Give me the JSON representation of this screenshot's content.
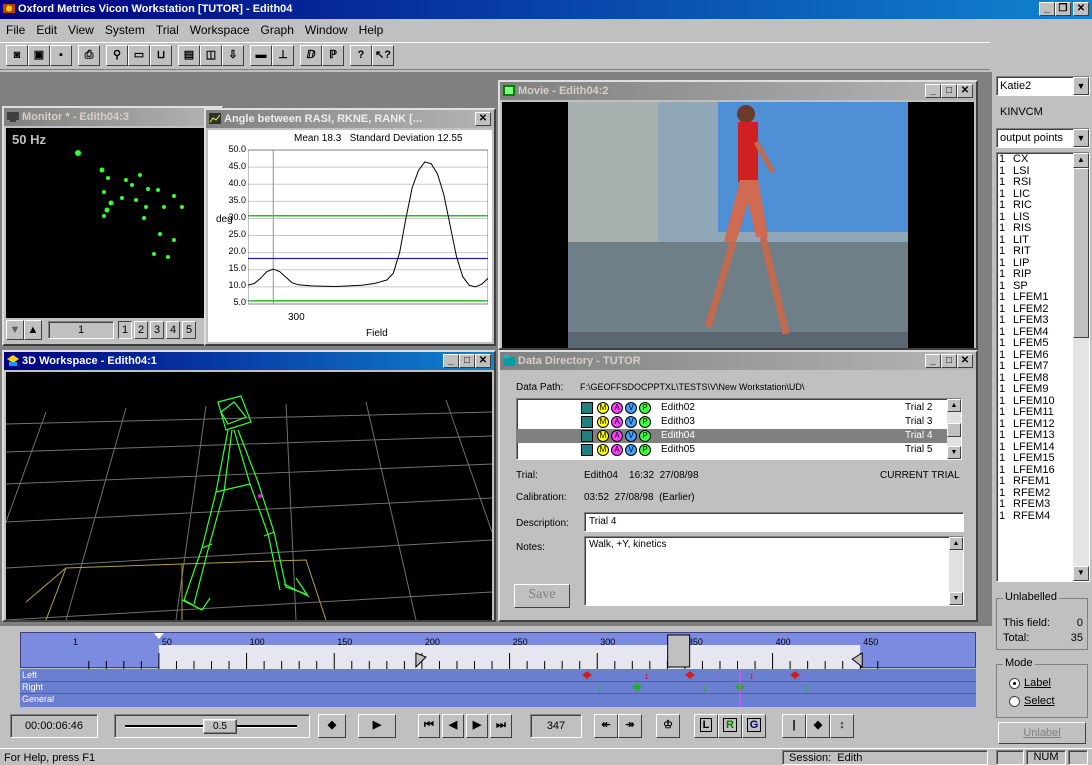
{
  "app": {
    "title": "Oxford Metrics Vicon Workstation [TUTOR] - Edith04"
  },
  "menu": [
    {
      "label": "File"
    },
    {
      "label": "Edit"
    },
    {
      "label": "View"
    },
    {
      "label": "System"
    },
    {
      "label": "Trial"
    },
    {
      "label": "Workspace"
    },
    {
      "label": "Graph"
    },
    {
      "label": "Window"
    },
    {
      "label": "Help"
    }
  ],
  "toolbar": {
    "icons": [
      "new-icon",
      "open-icon",
      "save-icon",
      "print-icon",
      "run-icon",
      "monitor-icon",
      "capture-icon",
      "pipeline-icon",
      "camera-icon",
      "export-icon",
      "graph-icon",
      "axis-icon",
      "reconstruct-icon",
      "label-icon",
      "help-icon",
      "context-help-icon"
    ]
  },
  "monitor": {
    "title": "Monitor * - Edith04:3",
    "rate": "50 Hz",
    "frame_value": "1",
    "pages": [
      "1",
      "2",
      "3",
      "4",
      "5"
    ]
  },
  "angle_graph": {
    "title": "Angle between RASI, RKNE, RANK [...",
    "stats": "Mean 18.3   Standard Deviation 12.55",
    "ylabel": "deg",
    "xlabel": "Field",
    "xtick": "300",
    "yticks": [
      "50.0",
      "45.0",
      "40.0",
      "35.0",
      "30.0",
      "25.0",
      "20.0",
      "15.0",
      "10.0",
      "5.0"
    ]
  },
  "chart_data": {
    "type": "line",
    "title": "Angle between RASI, RKNE, RANK",
    "ylabel": "deg",
    "xlabel": "Field",
    "ylim": [
      5,
      50
    ],
    "xlim": [
      280,
      470
    ],
    "x": [
      280,
      285,
      290,
      295,
      300,
      305,
      310,
      315,
      320,
      330,
      340,
      350,
      360,
      370,
      380,
      390,
      395,
      400,
      405,
      410,
      415,
      420,
      425,
      430,
      435,
      440,
      445,
      450,
      455,
      460,
      465,
      470
    ],
    "values": [
      10.5,
      11,
      12.5,
      14.5,
      15.2,
      14.5,
      12.8,
      11.2,
      10.6,
      10.3,
      10.2,
      10.1,
      10.3,
      10.5,
      11,
      12,
      14,
      20,
      30,
      39,
      44,
      46.5,
      46,
      43,
      37,
      28,
      19,
      13,
      10.5,
      10,
      10.8,
      12.5
    ],
    "reference_lines": {
      "mean": 18.3,
      "upper": 30.8,
      "lower": 5.9
    }
  },
  "movie": {
    "title": "Movie - Edith04:2"
  },
  "workspace3d": {
    "title": "3D Workspace - Edith04:1"
  },
  "data_dir": {
    "title": "Data Directory - TUTOR",
    "data_path_label": "Data Path:",
    "data_path": "F:\\GEOFFSDOCPPTXL\\TESTS\\V\\New Workstation\\UD\\",
    "trials": [
      {
        "name": "Edith02",
        "trial": "Trial 2"
      },
      {
        "name": "Edith03",
        "trial": "Trial 3"
      },
      {
        "name": "Edith04",
        "trial": "Trial 4",
        "selected": true
      },
      {
        "name": "Edith05",
        "trial": "Trial 5"
      }
    ],
    "badges": [
      "M",
      "A",
      "V",
      "P"
    ],
    "trial_label": "Trial:",
    "trial_value": "Edith04    16:32  27/08/98",
    "current": "CURRENT TRIAL",
    "calibration_label": "Calibration:",
    "calibration_value": "03:52  27/08/98  (Earlier)",
    "description_label": "Description:",
    "description_value": "Trial 4",
    "notes_label": "Notes:",
    "notes_value": "Walk, +Y, kinetics",
    "save_label": "Save"
  },
  "right_panel": {
    "subject": "Katie2",
    "model": "KINVCM",
    "list_mode": "output points",
    "markers": [
      "CX",
      "LSI",
      "RSI",
      "LIC",
      "RIC",
      "LIS",
      "RIS",
      "LIT",
      "RIT",
      "LIP",
      "RIP",
      "SP",
      "LFEM1",
      "LFEM2",
      "LFEM3",
      "LFEM4",
      "LFEM5",
      "LFEM6",
      "LFEM7",
      "LFEM8",
      "LFEM9",
      "LFEM10",
      "LFEM11",
      "LFEM12",
      "LFEM13",
      "LFEM14",
      "LFEM15",
      "LFEM16",
      "RFEM1",
      "RFEM2",
      "RFEM3",
      "RFEM4"
    ],
    "marker_count": "1",
    "unlabelled_title": "Unlabelled",
    "this_field_label": "This field:",
    "this_field_value": "0",
    "total_label": "Total:",
    "total_value": "35",
    "mode_title": "Mode",
    "mode_label": "Label",
    "mode_select": "Select",
    "unlabel_btn": "Unlabel"
  },
  "timeline": {
    "ticks": [
      "1",
      "50",
      "100",
      "150",
      "200",
      "250",
      "300",
      "350",
      "400",
      "450"
    ],
    "rows": [
      "Left",
      "Right",
      "General"
    ]
  },
  "playback": {
    "time": "00:00:06:46",
    "speed": "0.5",
    "frame": "347",
    "btn_L": "L",
    "btn_R": "R",
    "btn_G": "G"
  },
  "statusbar": {
    "help": "For Help, press F1",
    "session": "Session:  Edith",
    "num": "NUM"
  },
  "colors": {
    "title_active": "#000080",
    "workspace_bg": "#000000",
    "timeline_bg": "#6b7fd6",
    "event_left": "#cc0000",
    "event_right": "#00aa00"
  }
}
